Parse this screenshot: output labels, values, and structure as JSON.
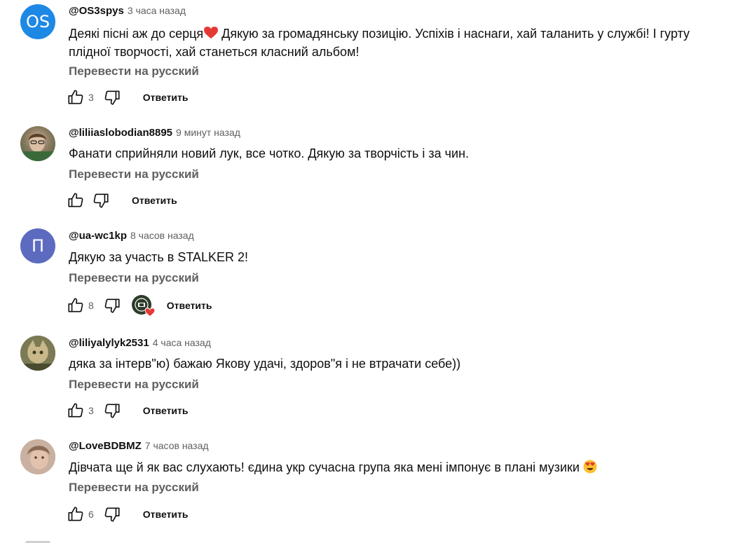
{
  "comments": [
    {
      "author": "@OS3spys",
      "time": "3 часа назад",
      "text_before_emoji": "Деякі пісні аж до серця",
      "text_after_emoji": " Дякую за громадянську позицію. Успіхів і наснаги, хай таланить у службі! І гурту плідної творчості, хай станеться класний альбом!",
      "translate": "Перевести на русский",
      "likes": "3",
      "reply": "Ответить",
      "avatar": {
        "type": "initials",
        "initials": "OS",
        "color": "#1e88e5"
      }
    },
    {
      "author": "@liliiaslobodian8895",
      "time": "9 минут назад",
      "text": "Фанати сприйняли новий лук, все чотко. Дякую за творчість і за чин.",
      "translate": "Перевести на русский",
      "likes": "",
      "reply": "Ответить",
      "avatar": {
        "type": "photo",
        "color": "#9a8a70"
      }
    },
    {
      "author": "@ua-wc1kp",
      "time": "8 часов назад",
      "text": "Дякую за участь в STALKER 2!",
      "translate": "Перевести на русский",
      "likes": "8",
      "reply": "Ответить",
      "avatar": {
        "type": "initials",
        "initials": "П",
        "color": "#5c6bc0"
      }
    },
    {
      "author": "@liliyalylyk2531",
      "time": "4 часа назад",
      "text": "дяка за інтерв\"ю) бажаю Якову удачі, здоров\"я і не втрачати себе))",
      "translate": "Перевести на русский",
      "likes": "3",
      "reply": "Ответить",
      "avatar": {
        "type": "photo",
        "color": "#6b6a45"
      }
    },
    {
      "author": "@LoveBDBMZ",
      "time": "7 часов назад",
      "text": "Дівчата ще й як вас слухають! єдина укр сучасна група яка мені імпонує в плані музики ",
      "translate": "Перевести на русский",
      "likes": "6",
      "reply": "Ответить",
      "avatar": {
        "type": "photo",
        "color": "#b89a8a"
      }
    }
  ],
  "icons": {
    "like": "thumbs-up-icon",
    "dislike": "thumbs-down-icon",
    "red_heart": "red-heart-emoji-icon",
    "heart_eyes": "heart-eyes-emoji-icon",
    "creator_heart": "creator-heart-badge-icon"
  },
  "colors": {
    "meta_text": "#606060",
    "heart": "#e53935"
  }
}
